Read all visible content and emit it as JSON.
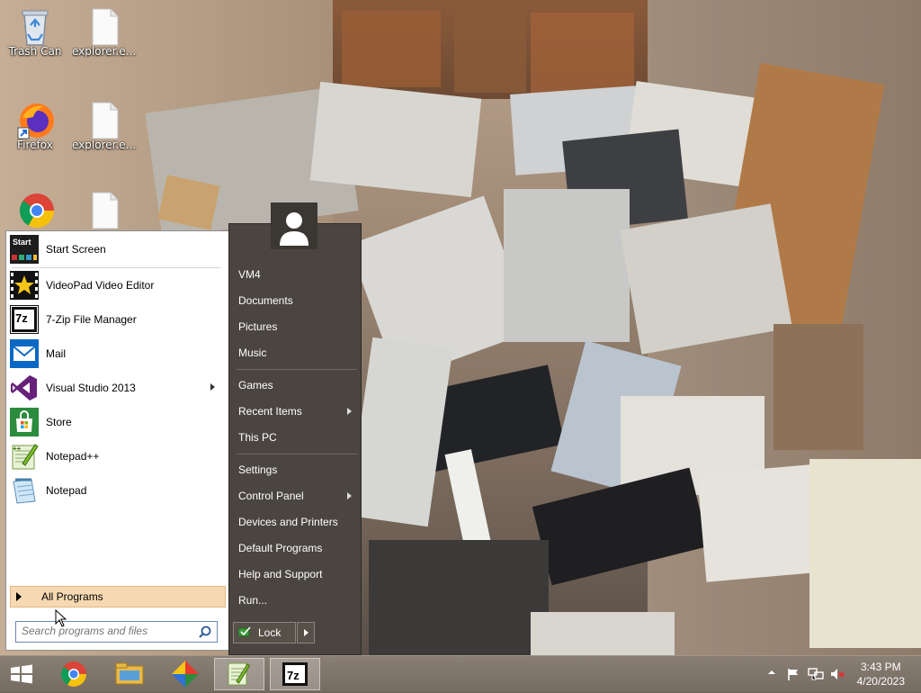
{
  "desktop": {
    "icons": [
      {
        "label": "Trash Can",
        "icon": "recycle-bin-icon"
      },
      {
        "label": "explorer.ex...",
        "icon": "file-icon"
      },
      {
        "label": "Firefox",
        "icon": "firefox-icon"
      },
      {
        "label": "explorer.ex...",
        "icon": "file-icon"
      },
      {
        "label": "",
        "icon": "chrome-icon"
      },
      {
        "label": "",
        "icon": "file-icon"
      }
    ]
  },
  "start_menu": {
    "programs": [
      {
        "label": "Start Screen",
        "icon": "start-screen-icon",
        "badge": "Start",
        "has_submenu": false
      },
      {
        "label": "VideoPad Video Editor",
        "icon": "videopad-icon",
        "has_submenu": false
      },
      {
        "label": "7-Zip File Manager",
        "icon": "seven-zip-icon",
        "badge": "7z",
        "has_submenu": false
      },
      {
        "label": "Mail",
        "icon": "mail-icon",
        "has_submenu": false
      },
      {
        "label": "Visual Studio 2013",
        "icon": "visual-studio-icon",
        "has_submenu": true
      },
      {
        "label": "Store",
        "icon": "store-icon",
        "has_submenu": false
      },
      {
        "label": "Notepad++",
        "icon": "notepadpp-icon",
        "has_submenu": false
      },
      {
        "label": "Notepad",
        "icon": "notepad-icon",
        "has_submenu": false
      }
    ],
    "all_programs": "All Programs",
    "search_placeholder": "Search programs and files",
    "right_links": [
      {
        "label": "VM4",
        "has_submenu": false
      },
      {
        "label": "Documents",
        "has_submenu": false
      },
      {
        "label": "Pictures",
        "has_submenu": false
      },
      {
        "label": "Music",
        "has_submenu": false
      },
      {
        "label": "Games",
        "has_submenu": false
      },
      {
        "label": "Recent Items",
        "has_submenu": true
      },
      {
        "label": "This PC",
        "has_submenu": false
      },
      {
        "label": "Settings",
        "has_submenu": false
      },
      {
        "label": "Control Panel",
        "has_submenu": true
      },
      {
        "label": "Devices and Printers",
        "has_submenu": false
      },
      {
        "label": "Default Programs",
        "has_submenu": false
      },
      {
        "label": "Help and Support",
        "has_submenu": false
      },
      {
        "label": "Run...",
        "has_submenu": false
      }
    ],
    "lock_label": "Lock"
  },
  "taskbar": {
    "pinned": [
      {
        "name": "chrome-icon",
        "active": false
      },
      {
        "name": "file-explorer-icon",
        "active": false
      },
      {
        "name": "pinwheel-app-icon",
        "active": false
      },
      {
        "name": "notepadpp-icon",
        "active": true
      },
      {
        "name": "seven-zip-icon",
        "active": true
      }
    ],
    "clock_time": "3:43 PM",
    "clock_date": "4/20/2023"
  },
  "colors": {
    "all_programs_highlight": "#f6d9b2",
    "right_pane": "#4a4540",
    "taskbar": "#7d7267"
  }
}
